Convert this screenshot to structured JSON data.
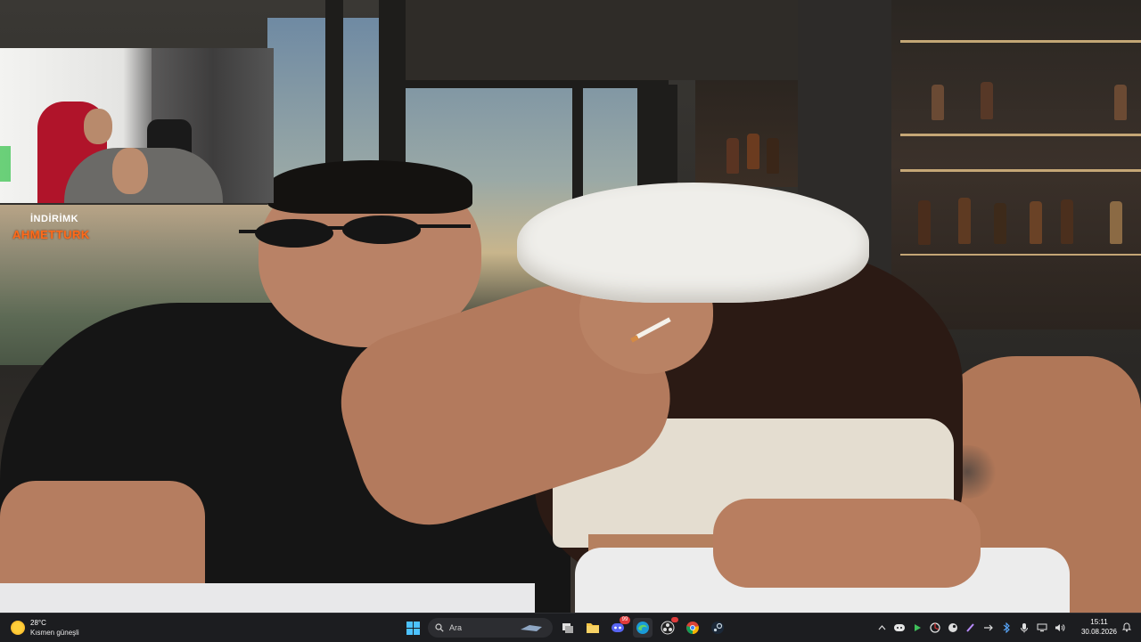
{
  "stream_overlay": {
    "label": "İNDİRİMK",
    "name": "AHMETTURK"
  },
  "taskbar": {
    "weather": {
      "temperature": "28°C",
      "condition": "Kısmen güneşli",
      "icon": "sun-cloud-icon"
    },
    "start_icon": "windows-start-icon",
    "search": {
      "placeholder": "Ara"
    },
    "pinned_apps": [
      {
        "name": "task-view-icon"
      },
      {
        "name": "file-explorer-icon"
      },
      {
        "name": "discord-icon",
        "badge": "99"
      },
      {
        "name": "edge-icon"
      },
      {
        "name": "obs-icon"
      },
      {
        "name": "chrome-icon"
      },
      {
        "name": "steam-icon"
      }
    ],
    "tray": {
      "icons": [
        "chevron-up-icon",
        "discord-tray-icon",
        "play-icon",
        "nvidia-icon",
        "steam-tray-icon",
        "brush-icon",
        "arrow-icon",
        "bluetooth-icon",
        "microphone-icon",
        "network-icon",
        "volume-icon"
      ]
    },
    "clock": {
      "time": "15:11",
      "date": "30.08.2026"
    }
  },
  "colors": {
    "taskbar_bg": "#1c1d20",
    "overlay_name": "#ff6a1a",
    "accent": "#4cc2ff"
  }
}
